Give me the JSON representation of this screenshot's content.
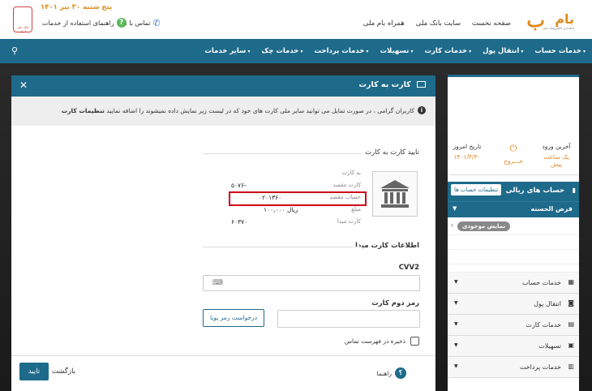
{
  "header": {
    "logo_text": "بام",
    "logo_glyph": "ب",
    "logo_sub": "بانکداری الکترونیک ملی",
    "links": [
      "صفحه نخست",
      "سایت بانک ملی",
      "همراه بام ملی"
    ],
    "date": "پنج شنبه ۳۰ تیر ۱۴۰۱",
    "contact": "تماس با ما",
    "guide": "راهنمای استفاده از خدمات",
    "seal_text": "بانک ملی ایران"
  },
  "nav": {
    "items": [
      "خدمات حساب",
      "انتقال پول",
      "خدمات کارت",
      "تسهیلات",
      "خدمات پرداخت",
      "خدمات چک",
      "سایر خدمات"
    ]
  },
  "sidebar": {
    "last_login_label": "آخرین ورود",
    "last_login_value": "یک ساعت پیش",
    "logout_label": "خـــروج",
    "today_label": "تاریخ امروز",
    "today_value": "۱۴۰۱/۴/۳۰",
    "rial_accounts": "حساب های ریالی",
    "account_settings": "تنظیمات حساب ها",
    "qard": "قرض الحسنه",
    "show_balance": "نمایش موجودی",
    "services": [
      "خدمات حساب",
      "انتقال پول",
      "خدمات کارت",
      "تسهیلات",
      "خدمات پرداخت"
    ]
  },
  "modal": {
    "title": "کارت به کارت",
    "alert_text": "کاربران گرامی ، در صورت تمایل می توانید سایر ملی کارت های خود که در لیست زیر نمایش داده نمیشوند را اضافه نمایید",
    "alert_link": "تنظیمات کارت",
    "confirm_section": "تایید کارت به کارت",
    "to_card": "به کارت",
    "dest_card_label": "کارت مقصد",
    "dest_card_value": "۵۰۷۶-",
    "dest_account_label": "حساب مقصد",
    "dest_account_value": "۰۲۰۱۳۶۰",
    "amount_label": "مبلغ",
    "amount_value": "۱۰۰,۰۰۰ ریال",
    "origin_card_label": "کارت مبدا",
    "origin_card_value": "۶۰۳۷۰",
    "origin_section": "اطلاعات کارت مبدا",
    "cvv_label": "CVV2",
    "pin_label": "رمز دوم کارت",
    "otp_button": "درخواست رمز پویا",
    "save_contact": "ذخیره در فهرست تماس",
    "guide": "راهنما",
    "back": "بازگشت",
    "confirm": "تایید"
  }
}
